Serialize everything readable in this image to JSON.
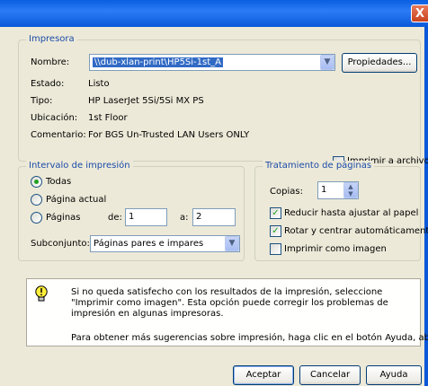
{
  "window": {
    "close_glyph": "X"
  },
  "printer": {
    "legend": "Impresora",
    "name_label": "Nombre:",
    "name_value": "\\\\dub-xlan-print\\HP5Si-1st_A",
    "properties_button": "Propiedades...",
    "status_label": "Estado:",
    "status_value": "Listo",
    "type_label": "Tipo:",
    "type_value": "HP LaserJet 5Si/5Si MX PS",
    "location_label": "Ubicación:",
    "location_value": "1st Floor",
    "comment_label": "Comentario:",
    "comment_value": "For BGS Un-Trusted LAN Users ONLY",
    "print_to_file": {
      "label": "Imprimir a archivo",
      "checked": false
    }
  },
  "range": {
    "legend": "Intervalo de impresión",
    "all": "Todas",
    "current": "Página actual",
    "pages": "Páginas",
    "from_label": "de:",
    "from_value": "1",
    "to_label": "a:",
    "to_value": "2",
    "subset_label": "Subconjunto:",
    "subset_value": "Páginas pares e impares",
    "selected": "all"
  },
  "handling": {
    "legend": "Tratamiento de páginas",
    "copies_label": "Copias:",
    "copies_value": "1",
    "options": [
      {
        "label": "Reducir hasta ajustar al papel",
        "checked": true
      },
      {
        "label": "Rotar y centrar automáticamente",
        "checked": true
      },
      {
        "label": "Imprimir como imagen",
        "checked": false
      }
    ]
  },
  "tip": {
    "icon": "lightbulb-icon",
    "line1": "Si no queda satisfecho con los resultados de la impresión, seleccione \"Imprimir como imagen\". Esta opción puede corregir los problemas de impresión en algunas impresoras.",
    "line2": "Para obtener más sugerencias sobre impresión, haga clic en el botón Ayuda, abajo."
  },
  "buttons": {
    "ok": "Aceptar",
    "cancel": "Cancelar",
    "help": "Ayuda"
  },
  "colors": {
    "title_bar": "#0a5ee0",
    "group_label": "#1c4ba8",
    "selection": "#316ac5"
  }
}
